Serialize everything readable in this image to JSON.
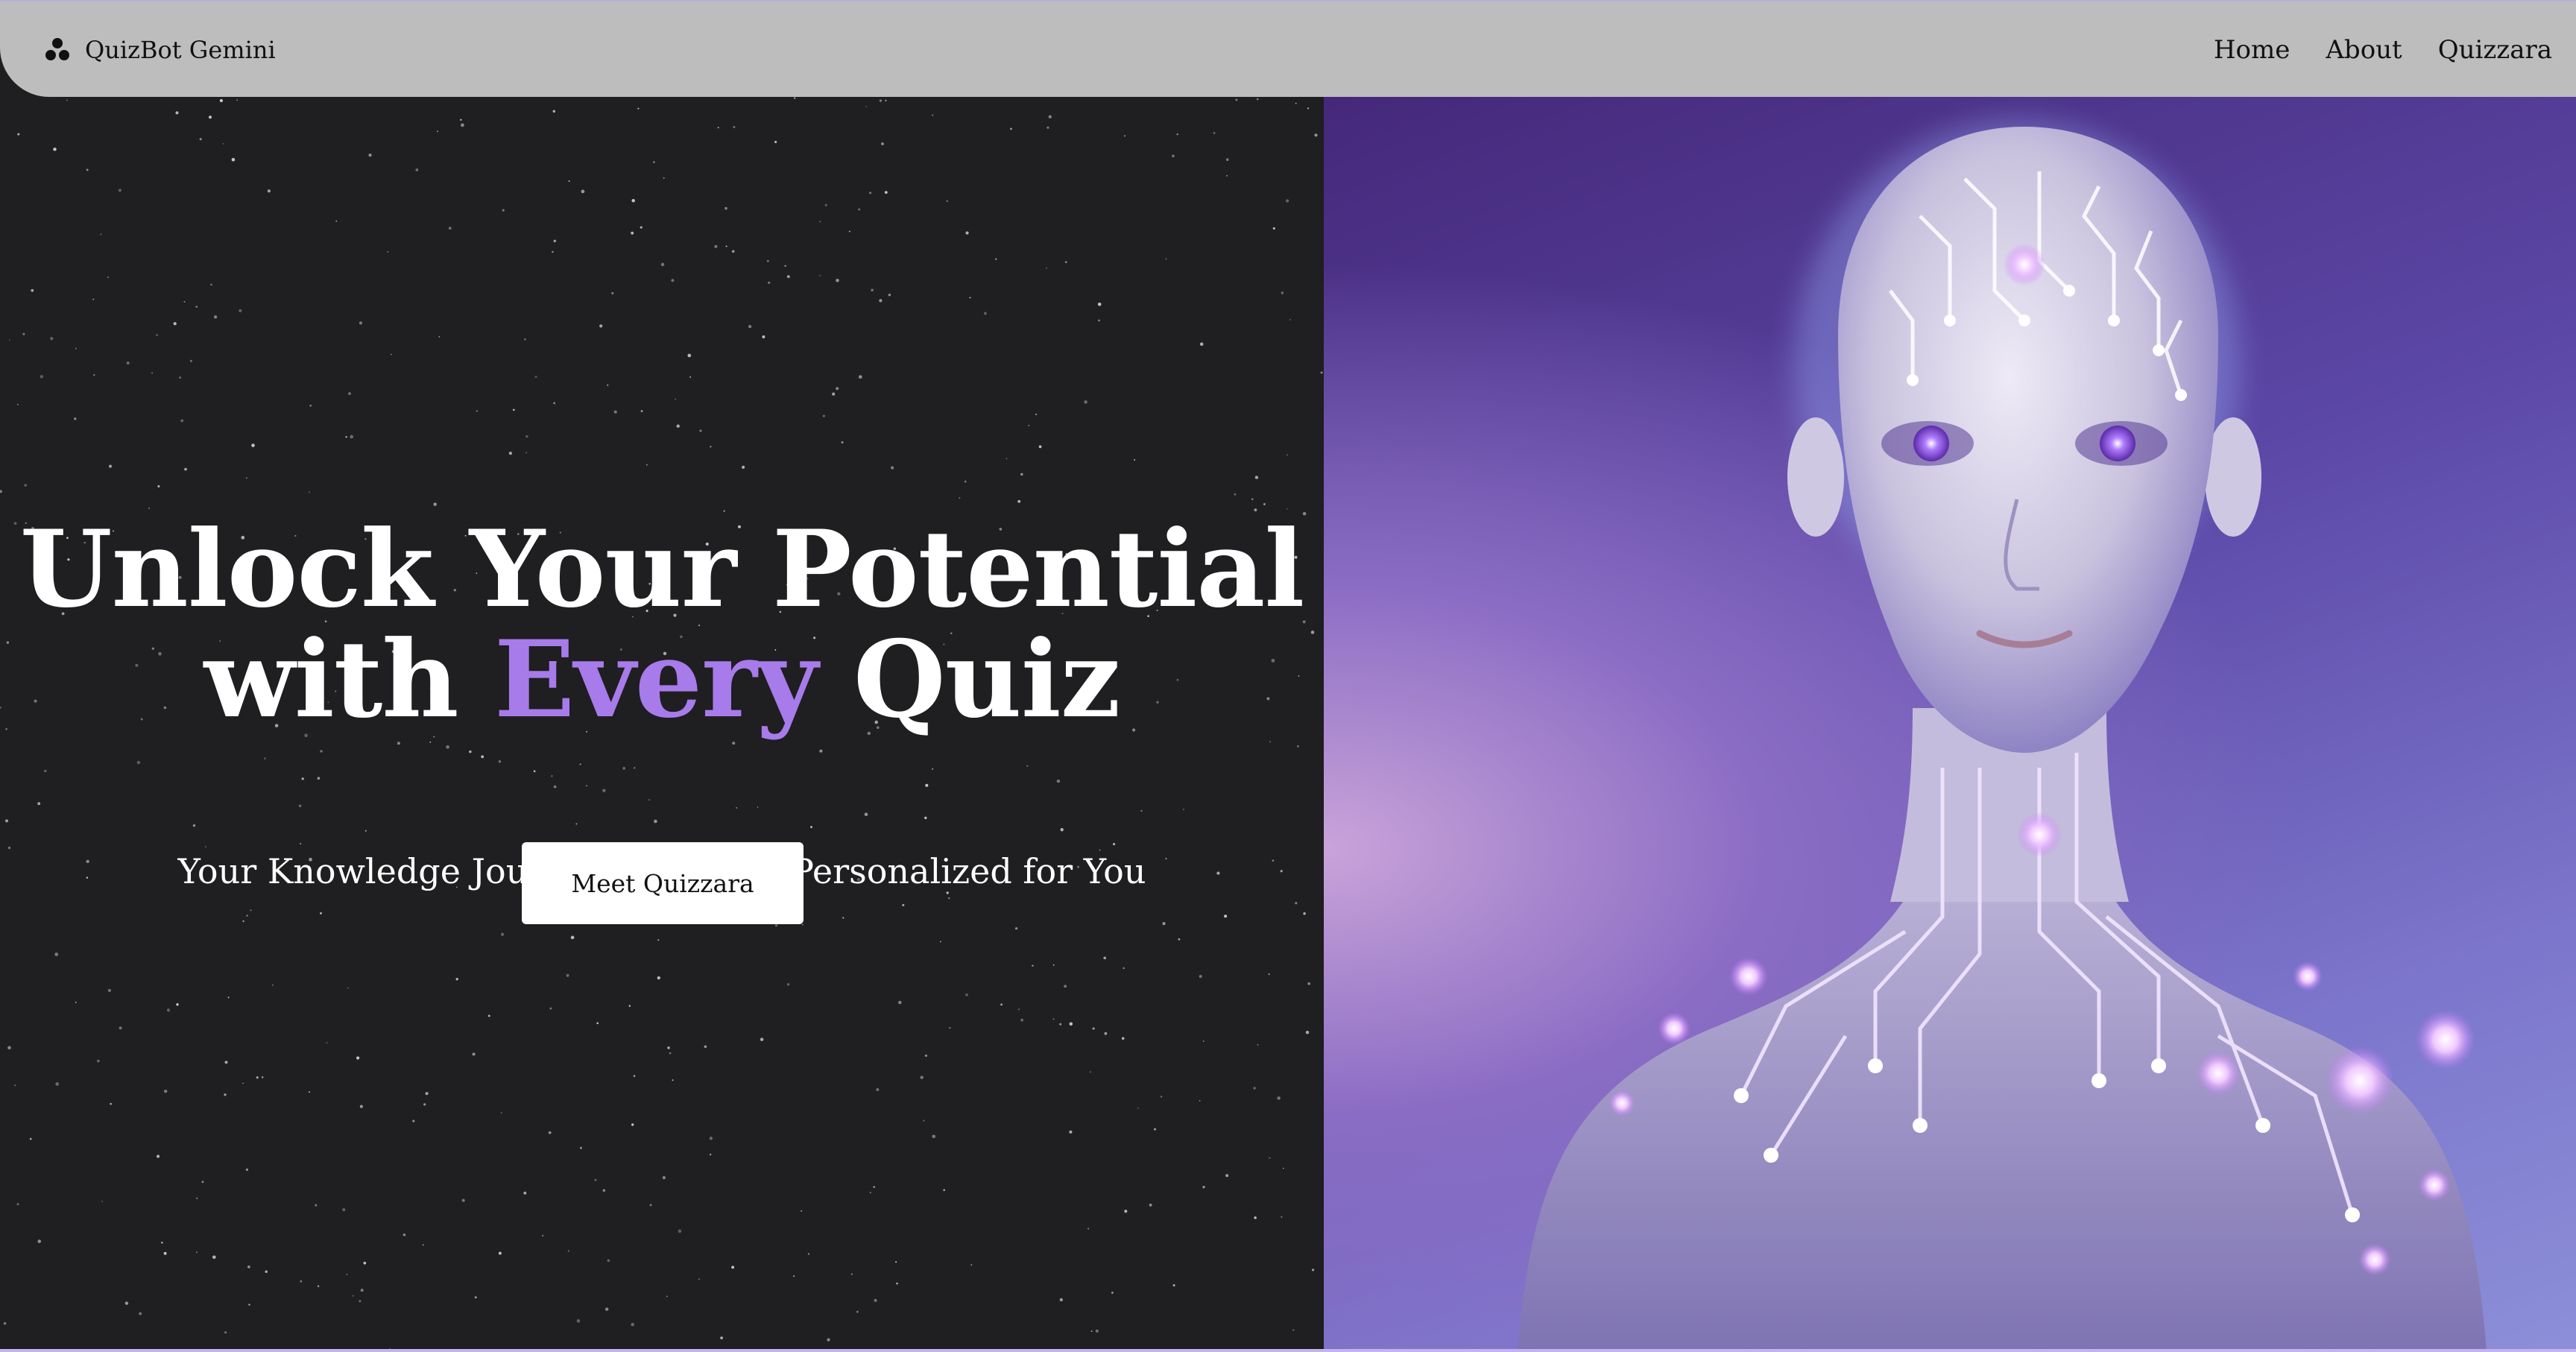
{
  "nav": {
    "brand": "QuizBot Gemini",
    "links": [
      "Home",
      "About",
      "Quizzara"
    ]
  },
  "hero": {
    "title_line1": "Unlock Your Potential",
    "title_line2_start": "with ",
    "title_accent": "Every",
    "title_line2_end": " Quiz",
    "subtitle": "Your Knowledge Journey, Uniquely Personalized for You",
    "cta_label": "Meet Quizzara"
  },
  "colors": {
    "nav_bg": "#bdbdbd",
    "page_bg": "#1f1e20",
    "accent": "#a77bea",
    "cta_bg": "#ffffff"
  },
  "icons": {
    "brand": "three-dots-cluster-icon"
  }
}
